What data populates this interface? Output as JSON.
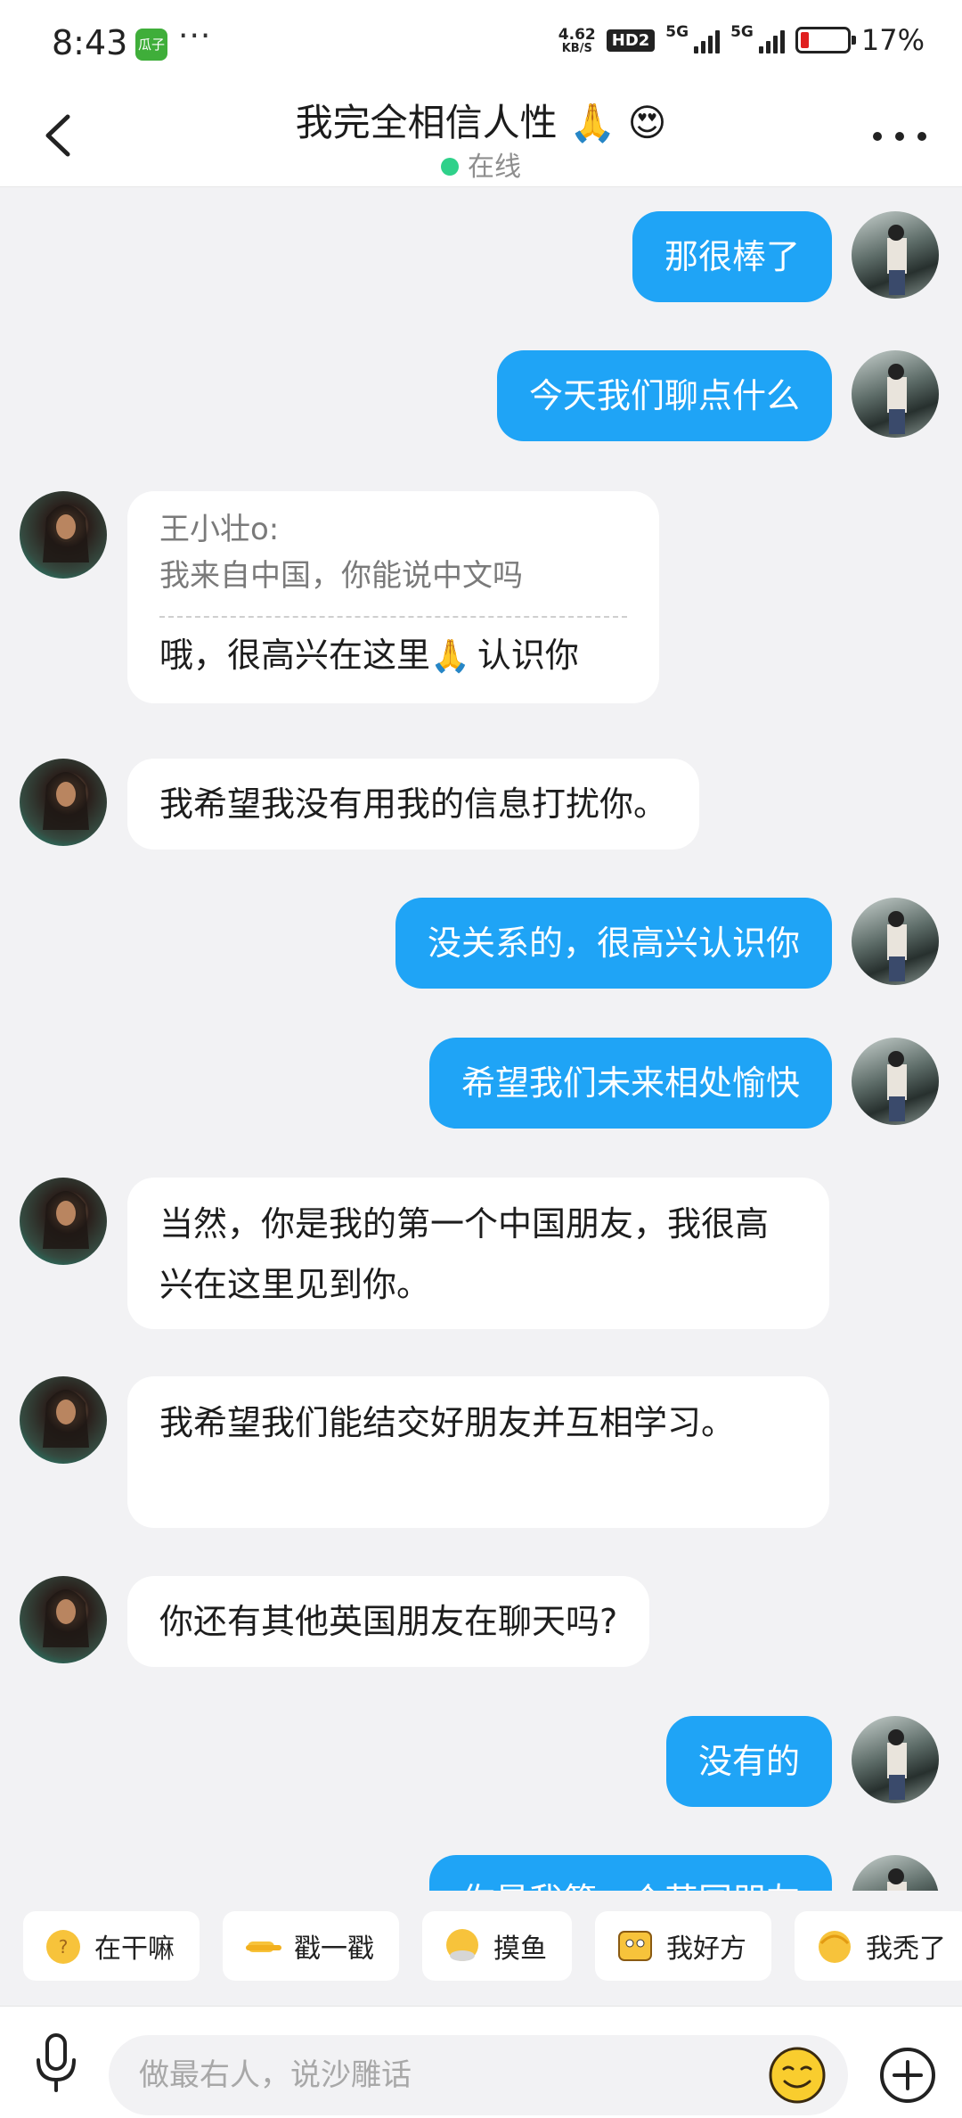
{
  "status_bar": {
    "time": "8:43",
    "app_badge": "瓜子",
    "more": "···",
    "net_speed_value": "4.62",
    "net_speed_unit": "KB/S",
    "hd_badge": "HD2",
    "sim1": "5G",
    "sim2": "5G",
    "battery_percent": "17%",
    "battery_color": "#e02020"
  },
  "header": {
    "title": "我完全相信人性 🙏 😍",
    "status": "在线",
    "status_color": "#2fd18a"
  },
  "messages": [
    {
      "side": "me",
      "text": "那很棒了"
    },
    {
      "side": "me",
      "text": "今天我们聊点什么"
    },
    {
      "side": "her",
      "quote_sender": "王小壮o:",
      "quote_text": "我来自中国，你能说中文吗",
      "text_before": "哦，很高兴在这里",
      "emoji": "🙏",
      "text_after": "认识你"
    },
    {
      "side": "her",
      "text": "我希望我没有用我的信息打扰你。"
    },
    {
      "side": "me",
      "text": "没关系的，很高兴认识你"
    },
    {
      "side": "me",
      "text": "希望我们未来相处愉快"
    },
    {
      "side": "her",
      "text": "当然，你是我的第一个中国朋友，我很高兴在这里见到你。"
    },
    {
      "side": "her",
      "text": "我希望我们能结交好朋友并互相学习。"
    },
    {
      "side": "her",
      "text": "你还有其他英国朋友在聊天吗?"
    },
    {
      "side": "me",
      "text": "没有的"
    },
    {
      "side": "me",
      "text": "你是我第一个英国朋友"
    }
  ],
  "quick_replies": [
    {
      "label": "在干嘛",
      "icon": "sticker-question-icon"
    },
    {
      "label": "戳一戳",
      "icon": "pointing-hand-icon"
    },
    {
      "label": "摸鱼",
      "icon": "sticker-fish-icon"
    },
    {
      "label": "我好方",
      "icon": "square-face-icon"
    },
    {
      "label": "我秃了",
      "icon": "sticker-bald-icon"
    }
  ],
  "input": {
    "placeholder": "做最右人，说沙雕话"
  },
  "colors": {
    "my_bubble": "#1fa4f6",
    "their_bubble": "#ffffff",
    "background": "#f2f2f4"
  }
}
